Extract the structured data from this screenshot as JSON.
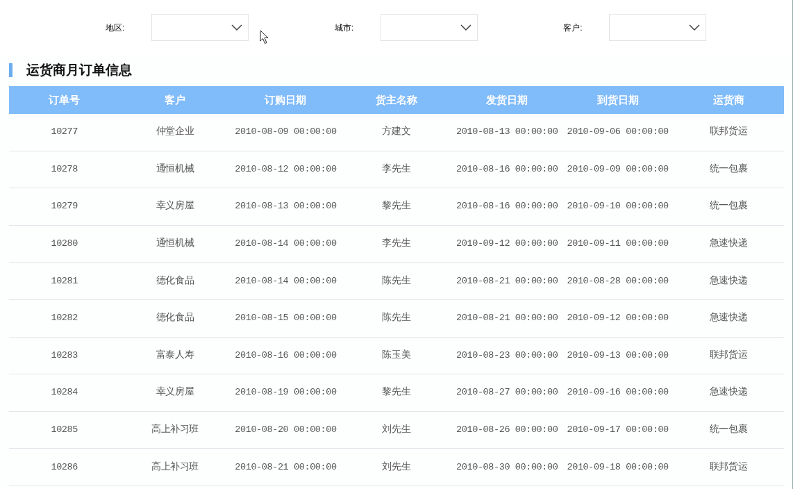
{
  "filters": [
    {
      "label": "地区:"
    },
    {
      "label": "城市:"
    },
    {
      "label": "客户:"
    }
  ],
  "title": "运货商月订单信息",
  "table": {
    "columns": [
      "订单号",
      "客户",
      "订购日期",
      "货主名称",
      "发货日期",
      "到货日期",
      "运货商"
    ],
    "rows": [
      [
        "10277",
        "仲堂企业",
        "2010-08-09 00:00:00",
        "方建文",
        "2010-08-13 00:00:00",
        "2010-09-06 00:00:00",
        "联邦货运"
      ],
      [
        "10278",
        "通恒机械",
        "2010-08-12 00:00:00",
        "李先生",
        "2010-08-16 00:00:00",
        "2010-09-09 00:00:00",
        "统一包裹"
      ],
      [
        "10279",
        "幸义房屋",
        "2010-08-13 00:00:00",
        "黎先生",
        "2010-08-16 00:00:00",
        "2010-09-10 00:00:00",
        "统一包裹"
      ],
      [
        "10280",
        "通恒机械",
        "2010-08-14 00:00:00",
        "李先生",
        "2010-09-12 00:00:00",
        "2010-09-11 00:00:00",
        "急速快递"
      ],
      [
        "10281",
        "德化食品",
        "2010-08-14 00:00:00",
        "陈先生",
        "2010-08-21 00:00:00",
        "2010-08-28 00:00:00",
        "急速快递"
      ],
      [
        "10282",
        "德化食品",
        "2010-08-15 00:00:00",
        "陈先生",
        "2010-08-21 00:00:00",
        "2010-09-12 00:00:00",
        "急速快递"
      ],
      [
        "10283",
        "富泰人寿",
        "2010-08-16 00:00:00",
        "陈玉美",
        "2010-08-23 00:00:00",
        "2010-09-13 00:00:00",
        "联邦货运"
      ],
      [
        "10284",
        "幸义房屋",
        "2010-08-19 00:00:00",
        "黎先生",
        "2010-08-27 00:00:00",
        "2010-09-16 00:00:00",
        "急速快递"
      ],
      [
        "10285",
        "高上补习班",
        "2010-08-20 00:00:00",
        "刘先生",
        "2010-08-26 00:00:00",
        "2010-09-17 00:00:00",
        "统一包裹"
      ],
      [
        "10286",
        "高上补习班",
        "2010-08-21 00:00:00",
        "刘先生",
        "2010-08-30 00:00:00",
        "2010-09-18 00:00:00",
        "联邦货运"
      ]
    ]
  }
}
